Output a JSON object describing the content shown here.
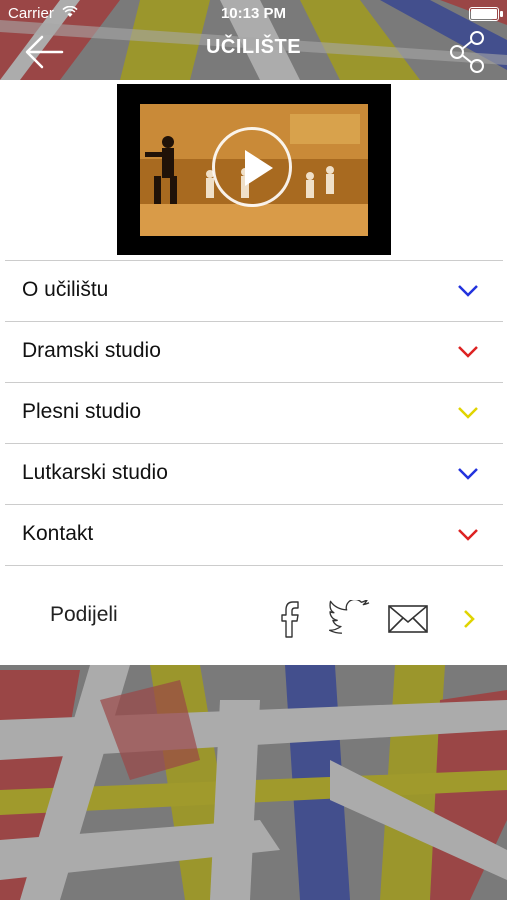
{
  "status_bar": {
    "carrier": "Carrier",
    "time": "10:13 PM"
  },
  "nav": {
    "title": "UČILIŠTE",
    "back_icon": "arrow-left-icon",
    "share_icon": "share-icon"
  },
  "video": {
    "thumbnail": "dance-studio-rehearsal",
    "overlay_icon": "play-icon"
  },
  "menu": {
    "items": [
      {
        "label": "O učilištu",
        "chevron_color": "#2233dd"
      },
      {
        "label": "Dramski studio",
        "chevron_color": "#dd2222"
      },
      {
        "label": "Plesni studio",
        "chevron_color": "#e0d400"
      },
      {
        "label": "Lutkarski studio",
        "chevron_color": "#2233dd"
      },
      {
        "label": "Kontakt",
        "chevron_color": "#dd2222"
      }
    ]
  },
  "share": {
    "label": "Podijeli",
    "icons": [
      "facebook-icon",
      "twitter-icon",
      "mail-icon",
      "chevron-right-icon"
    ],
    "more_color": "#e0d400"
  },
  "colors": {
    "blue": "#2233dd",
    "red": "#dd2222",
    "yellow": "#e0d400",
    "panel": "#ffffff"
  }
}
